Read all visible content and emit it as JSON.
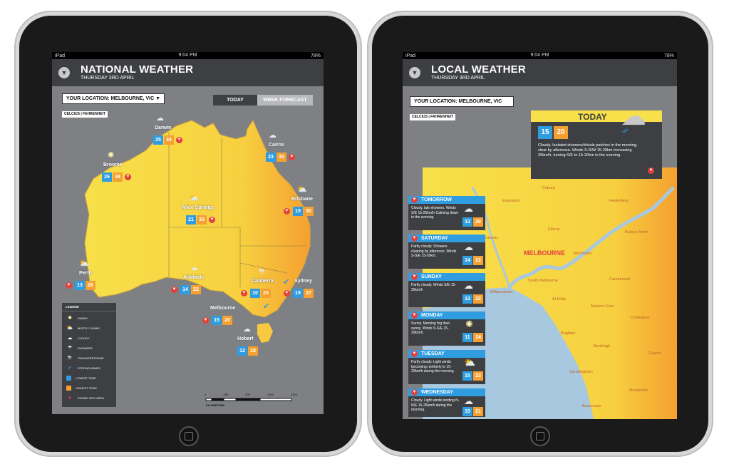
{
  "left": {
    "status": {
      "device": "iPad",
      "time": "9:04 PM",
      "battery": "78%"
    },
    "header": {
      "title": "NATIONAL WEATHER",
      "subtitle": "THURSDAY 3RD APRIL"
    },
    "location": "YOUR LOCATION:  MELBOURNE, VIC",
    "units": "CELCIUS  |  FAHRENHEIT",
    "tabs": {
      "today": "TODAY",
      "week": "WEEK FORECAST"
    },
    "cities": [
      {
        "name": "Darwin",
        "min": "25",
        "max": "34",
        "icon": "showers-icon"
      },
      {
        "name": "Cairns",
        "min": "23",
        "max": "30",
        "icon": "showers-icon"
      },
      {
        "name": "Broome",
        "min": "26",
        "max": "38",
        "icon": "sunny-icon"
      },
      {
        "name": "Alice Springs",
        "min": "21",
        "max": "33",
        "icon": "mostly-sunny-icon"
      },
      {
        "name": "Brisbane",
        "min": "19",
        "max": "30",
        "icon": "mostly-sunny-icon"
      },
      {
        "name": "Perth",
        "min": "13",
        "max": "26",
        "icon": "mostly-sunny-icon"
      },
      {
        "name": "Adelaide",
        "min": "14",
        "max": "22",
        "icon": "cloudy-icon"
      },
      {
        "name": "Canberra",
        "min": "10",
        "max": "23",
        "icon": "thunderstorms-icon"
      },
      {
        "name": "Sydney",
        "min": "19",
        "max": "27",
        "icon": "strong-winds-icon"
      },
      {
        "name": "Melbourne",
        "min": "15",
        "max": "20",
        "icon": "strong-winds-icon"
      },
      {
        "name": "Hobart",
        "min": "12",
        "max": "18",
        "icon": "cloudy-icon"
      }
    ],
    "legend": {
      "title": "LEGEND",
      "items": [
        "SUNNY",
        "MOSTLY SUNNY",
        "CLOUDY",
        "SHOWERS",
        "THUNDERSTORMS",
        "STRONG WINDS",
        "LOWEST TEMP",
        "HIGHEST TEMP",
        "ZOOMS INTO AREA"
      ]
    },
    "scale": {
      "ticks": [
        "0",
        "250",
        "500",
        "1000",
        "1500"
      ],
      "unit": "KILOMETRES"
    }
  },
  "right": {
    "status": {
      "device": "iPad",
      "time": "9:04 PM",
      "battery": "78%"
    },
    "header": {
      "title": "LOCAL WEATHER",
      "subtitle": "THURSDAY 3RD APRIL"
    },
    "location": "YOUR LOCATION:  MELBOURNE, VIC",
    "units": "CELCIUS  |  FAHRENHEIT",
    "today": {
      "label": "TODAY",
      "min": "15",
      "max": "20",
      "text": "Cloudy. Isolated showers/drizzle patches in the morning, clear by afternoon. Winds S-S/W 15-20km increasing 25km/h, turning S/E to 15-20km in the evening."
    },
    "forecast": [
      {
        "day": "TOMORROW",
        "text": "Cloudy, late showers. Winds S/E 15-25km/h Calming down in the evening.",
        "min": "13",
        "max": "20",
        "icon": "showers-icon"
      },
      {
        "day": "SATURDAY",
        "text": "Partly cloudy. Showers clearing by afternoon. Winds S-S/E 15-20km.",
        "min": "14",
        "max": "22",
        "icon": "cloudy-icon"
      },
      {
        "day": "SUNDAY",
        "text": "Partly cloudy. Winds S/E 15-25km/h",
        "min": "13",
        "max": "22",
        "icon": "showers-icon"
      },
      {
        "day": "MONDAY",
        "text": "Sunny. Morning fog then sunny. Winds S-S/E 15-20km/h.",
        "min": "11",
        "max": "24",
        "icon": "sunny-icon"
      },
      {
        "day": "TUESDAY",
        "text": "Partly cloudy. Light winds becoming northerly to 15-20km/h during the morning.",
        "min": "15",
        "max": "23",
        "icon": "mostly-sunny-icon"
      },
      {
        "day": "WEDNESDAY",
        "text": "Cloudy. Light winds tending N-N/E 15-25km/h during the morning.",
        "min": "15",
        "max": "21",
        "icon": "cloudy-icon"
      }
    ],
    "map": {
      "city": "MELBOURNE",
      "suburbs": [
        "Coburg",
        "Essendon",
        "Heidelberg",
        "Fitzroy",
        "Balwyn North",
        "Footscray",
        "Richmond",
        "Williamstown",
        "South Melbourne",
        "Camberwell",
        "St Kilda",
        "Malvern East",
        "Chadstone",
        "Brighton",
        "Bentleigh",
        "Clayton",
        "Sandringham",
        "Moorabbin",
        "Beaumaris"
      ]
    }
  },
  "colors": {
    "bezel": "#1a1a1a",
    "header": "#3d3f42",
    "screen_bg": "#7e8084",
    "land": "#f7e04a",
    "land_edge": "#f7a830",
    "water": "#a8c8e0",
    "min_temp": "#2f9de0",
    "max_temp": "#f5a030",
    "zoom": "#e3403a"
  }
}
